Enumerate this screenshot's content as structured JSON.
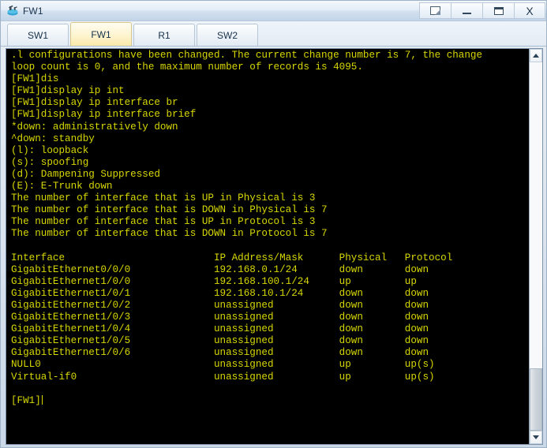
{
  "window": {
    "title": "FW1",
    "icon": "router-icon",
    "controls": [
      {
        "name": "restore-window-button",
        "glyph": "restore-icon",
        "label": ""
      },
      {
        "name": "minimize-window-button",
        "glyph": "minimize-icon",
        "label": ""
      },
      {
        "name": "maximize-window-button",
        "glyph": "maximize-icon",
        "label": ""
      },
      {
        "name": "close-window-button",
        "glyph": "close-icon",
        "label": "X"
      }
    ]
  },
  "tabs": [
    {
      "label": "SW1",
      "active": false
    },
    {
      "label": "FW1",
      "active": true
    },
    {
      "label": "R1",
      "active": false
    },
    {
      "label": "SW2",
      "active": false
    }
  ],
  "terminal": {
    "foreground_color": "#d7d700",
    "background_color": "#000000",
    "prompt": "[FW1]",
    "lines": [
      ".l configurations have been changed. The current change number is 7, the change",
      "loop count is 0, and the maximum number of records is 4095.",
      "[FW1]dis",
      "[FW1]display ip int",
      "[FW1]display ip interface br",
      "[FW1]display ip interface brief",
      "*down: administratively down",
      "^down: standby",
      "(l): loopback",
      "(s): spoofing",
      "(d): Dampening Suppressed",
      "(E): E-Trunk down",
      "The number of interface that is UP in Physical is 3",
      "The number of interface that is DOWN in Physical is 7",
      "The number of interface that is UP in Protocol is 3",
      "The number of interface that is DOWN in Protocol is 7",
      "",
      "Interface                         IP Address/Mask      Physical   Protocol",
      "GigabitEthernet0/0/0              192.168.0.1/24       down       down",
      "GigabitEthernet1/0/0              192.168.100.1/24     up         up",
      "GigabitEthernet1/0/1              192.168.10.1/24      down       down",
      "GigabitEthernet1/0/2              unassigned           down       down",
      "GigabitEthernet1/0/3              unassigned           down       down",
      "GigabitEthernet1/0/4              unassigned           down       down",
      "GigabitEthernet1/0/5              unassigned           down       down",
      "GigabitEthernet1/0/6              unassigned           down       down",
      "NULL0                             unassigned           up         up(s)",
      "Virtual-if0                       unassigned           up         up(s)",
      "",
      "[FW1]"
    ],
    "table": {
      "headers": [
        "Interface",
        "IP Address/Mask",
        "Physical",
        "Protocol"
      ],
      "rows": [
        [
          "GigabitEthernet0/0/0",
          "192.168.0.1/24",
          "down",
          "down"
        ],
        [
          "GigabitEthernet1/0/0",
          "192.168.100.1/24",
          "up",
          "up"
        ],
        [
          "GigabitEthernet1/0/1",
          "192.168.10.1/24",
          "down",
          "down"
        ],
        [
          "GigabitEthernet1/0/2",
          "unassigned",
          "down",
          "down"
        ],
        [
          "GigabitEthernet1/0/3",
          "unassigned",
          "down",
          "down"
        ],
        [
          "GigabitEthernet1/0/4",
          "unassigned",
          "down",
          "down"
        ],
        [
          "GigabitEthernet1/0/5",
          "unassigned",
          "down",
          "down"
        ],
        [
          "GigabitEthernet1/0/6",
          "unassigned",
          "down",
          "down"
        ],
        [
          "NULL0",
          "unassigned",
          "up",
          "up(s)"
        ],
        [
          "Virtual-if0",
          "unassigned",
          "up",
          "up(s)"
        ]
      ]
    },
    "counters": {
      "up_physical": "3",
      "down_physical": "7",
      "up_protocol": "3",
      "down_protocol": "7"
    },
    "change_number": "7",
    "loop_count": "0",
    "max_records": "4095"
  },
  "scrollbar": {
    "up_arrow": "scroll-up-icon",
    "down_arrow": "scroll-down-icon",
    "thumb_top_pct": 83,
    "thumb_height_pct": 17
  }
}
